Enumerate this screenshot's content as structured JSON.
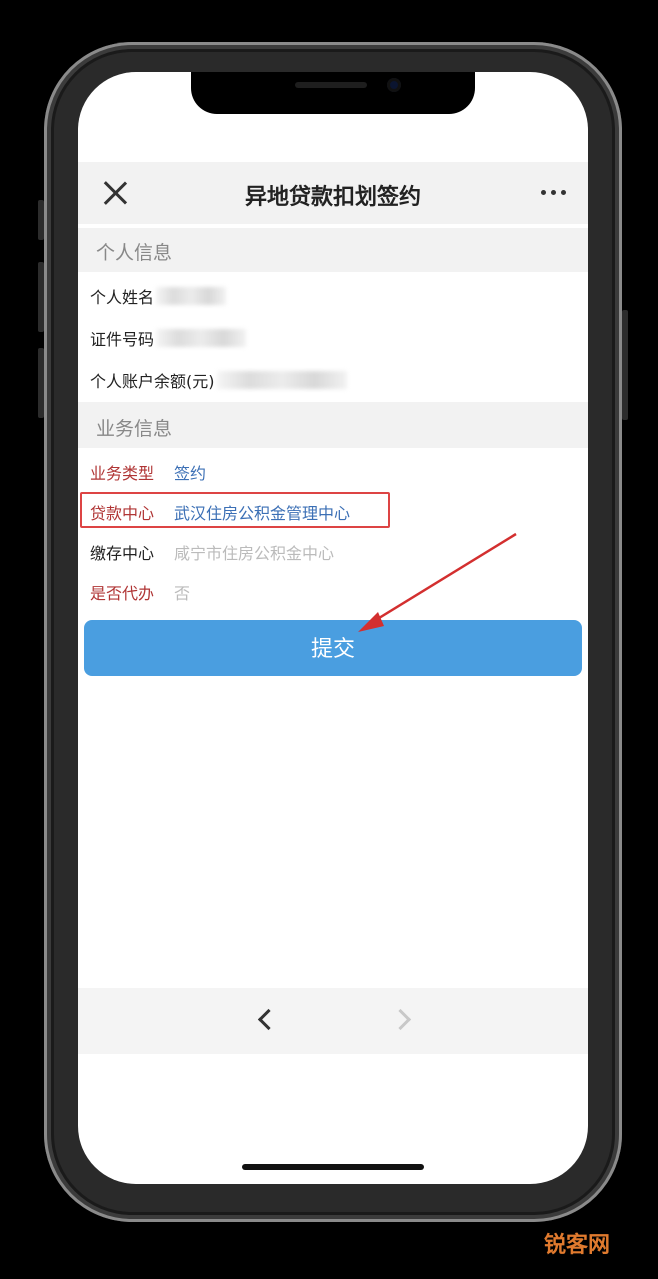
{
  "header": {
    "title": "异地贷款扣划签约"
  },
  "sections": {
    "personal": "个人信息",
    "business": "业务信息"
  },
  "personal": {
    "name_label": "个人姓名",
    "id_label": "证件号码",
    "balance_label": "个人账户余额(元)"
  },
  "business": {
    "type_label": "业务类型",
    "type_value": "签约",
    "loan_center_label": "贷款中心",
    "loan_center_value": "武汉住房公积金管理中心",
    "deposit_center_label": "缴存中心",
    "deposit_center_value": "咸宁市住房公积金中心",
    "agent_label": "是否代办",
    "agent_value": "否"
  },
  "actions": {
    "submit_label": "提交"
  },
  "watermark": "锐客网",
  "colors": {
    "accent": "#4a9ee0",
    "label_red": "#b03535",
    "value_blue": "#3b6fb5",
    "highlight": "#dd4444"
  }
}
